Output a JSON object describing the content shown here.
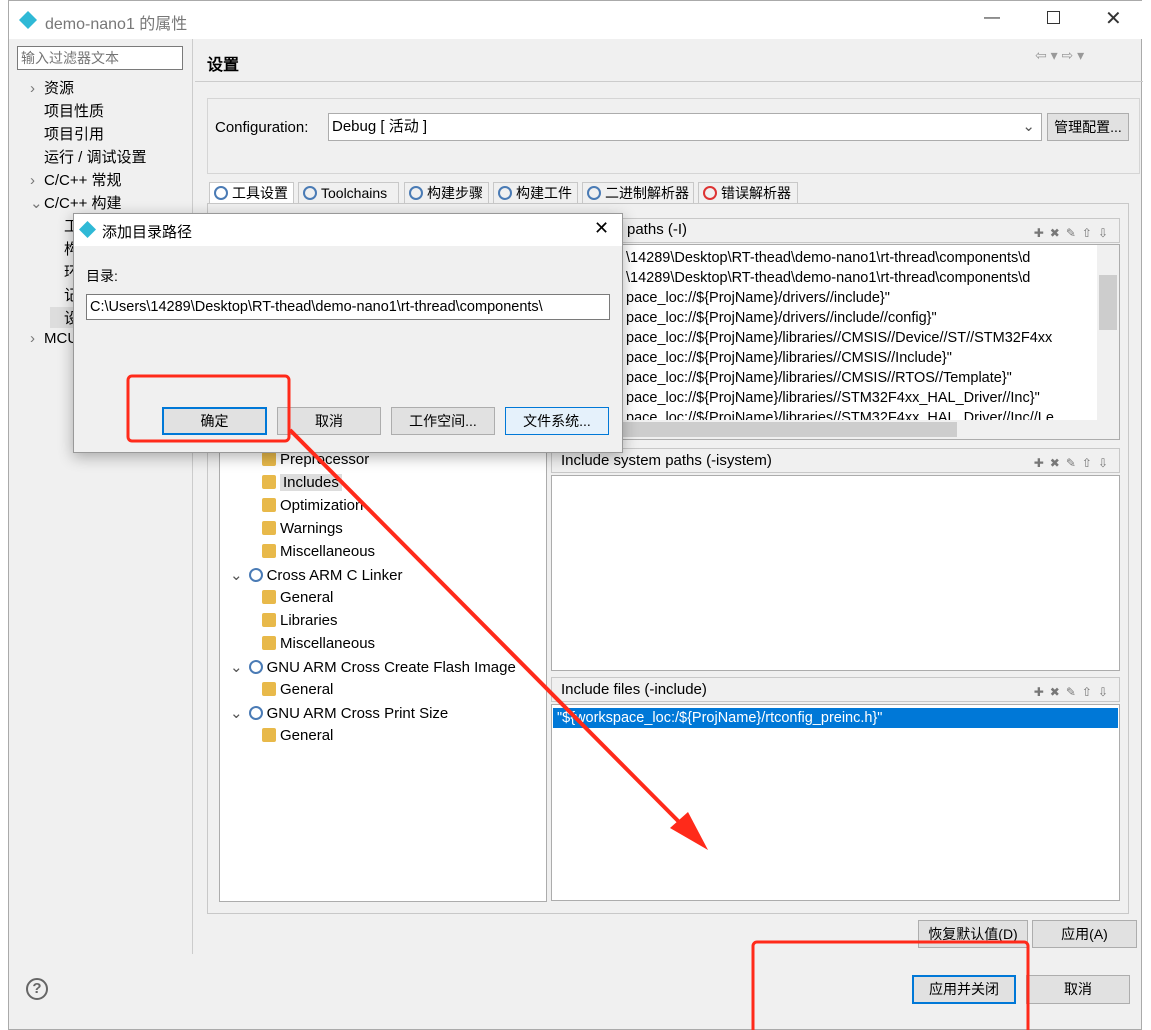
{
  "window": {
    "title": "demo-nano1 的属性"
  },
  "left": {
    "filter_placeholder": "输入过滤器文本",
    "tree": [
      {
        "label": "资源",
        "expander": "›"
      },
      {
        "label": "项目性质",
        "expander": ""
      },
      {
        "label": "项目引用",
        "expander": ""
      },
      {
        "label": "运行 / 调试设置",
        "expander": ""
      },
      {
        "label": "C/C++ 常规",
        "expander": "›"
      },
      {
        "label": "C/C++ 构建",
        "expander": "⌄"
      },
      {
        "label": "工",
        "expander": ""
      },
      {
        "label": "构",
        "expander": ""
      },
      {
        "label": "环",
        "expander": ""
      },
      {
        "label": "记",
        "expander": ""
      },
      {
        "label": "设",
        "expander": ""
      },
      {
        "label": "MCU",
        "expander": "›"
      }
    ]
  },
  "main": {
    "title": "设置",
    "configuration_label": "Configuration:",
    "configuration_value": "Debug [ 活动 ]",
    "manage_button": "管理配置...",
    "tabs": [
      "工具设置",
      "Toolchains",
      "构建步骤",
      "构建工件",
      "二进制解析器",
      "错误解析器"
    ],
    "tool_tree": [
      {
        "label": "Preprocessor",
        "level": 2
      },
      {
        "label": "Includes",
        "level": 2,
        "selected": true
      },
      {
        "label": "Optimization",
        "level": 2
      },
      {
        "label": "Warnings",
        "level": 2
      },
      {
        "label": "Miscellaneous",
        "level": 2
      },
      {
        "label": "Cross ARM C Linker",
        "level": 1
      },
      {
        "label": "General",
        "level": 2
      },
      {
        "label": "Libraries",
        "level": 2
      },
      {
        "label": "Miscellaneous",
        "level": 2
      },
      {
        "label": "GNU ARM Cross Create Flash Image",
        "level": 1
      },
      {
        "label": "General",
        "level": 2
      },
      {
        "label": "GNU ARM Cross Print Size",
        "level": 1
      },
      {
        "label": "General",
        "level": 2
      }
    ],
    "include_paths": {
      "title": "paths (-I)",
      "items": [
        "\\14289\\Desktop\\RT-thead\\demo-nano1\\rt-thread\\components\\d",
        "\\14289\\Desktop\\RT-thead\\demo-nano1\\rt-thread\\components\\d",
        "pace_loc://${ProjName}/drivers//include}\"",
        "pace_loc://${ProjName}/drivers//include//config}\"",
        "pace_loc://${ProjName}/libraries//CMSIS//Device//ST//STM32F4xx",
        "pace_loc://${ProjName}/libraries//CMSIS//Include}\"",
        "pace_loc://${ProjName}/libraries//CMSIS//RTOS//Template}\"",
        "pace_loc://${ProjName}/libraries//STM32F4xx_HAL_Driver//Inc}\"",
        "pace_loc://${ProjName}/libraries//STM32F4xx_HAL_Driver//Inc//Le"
      ]
    },
    "include_system_paths": {
      "title": "Include system paths (-isystem)",
      "items": []
    },
    "include_files": {
      "title": "Include files (-include)",
      "items": [
        "\"${workspace_loc:/${ProjName}/rtconfig_preinc.h}\""
      ]
    },
    "restore_defaults": "恢复默认值(D)",
    "apply": "应用(A)"
  },
  "footer": {
    "apply_close": "应用并关闭",
    "cancel": "取消"
  },
  "dialog": {
    "title": "添加目录路径",
    "dir_label": "目录:",
    "dir_value": "C:\\Users\\14289\\Desktop\\RT-thead\\demo-nano1\\rt-thread\\components\\",
    "ok": "确定",
    "cancel": "取消",
    "workspace": "工作空间...",
    "filesystem": "文件系统..."
  },
  "colors": {
    "selection": "#0078d7",
    "annotation": "#ff2a1a",
    "accent": "#0078d7"
  }
}
